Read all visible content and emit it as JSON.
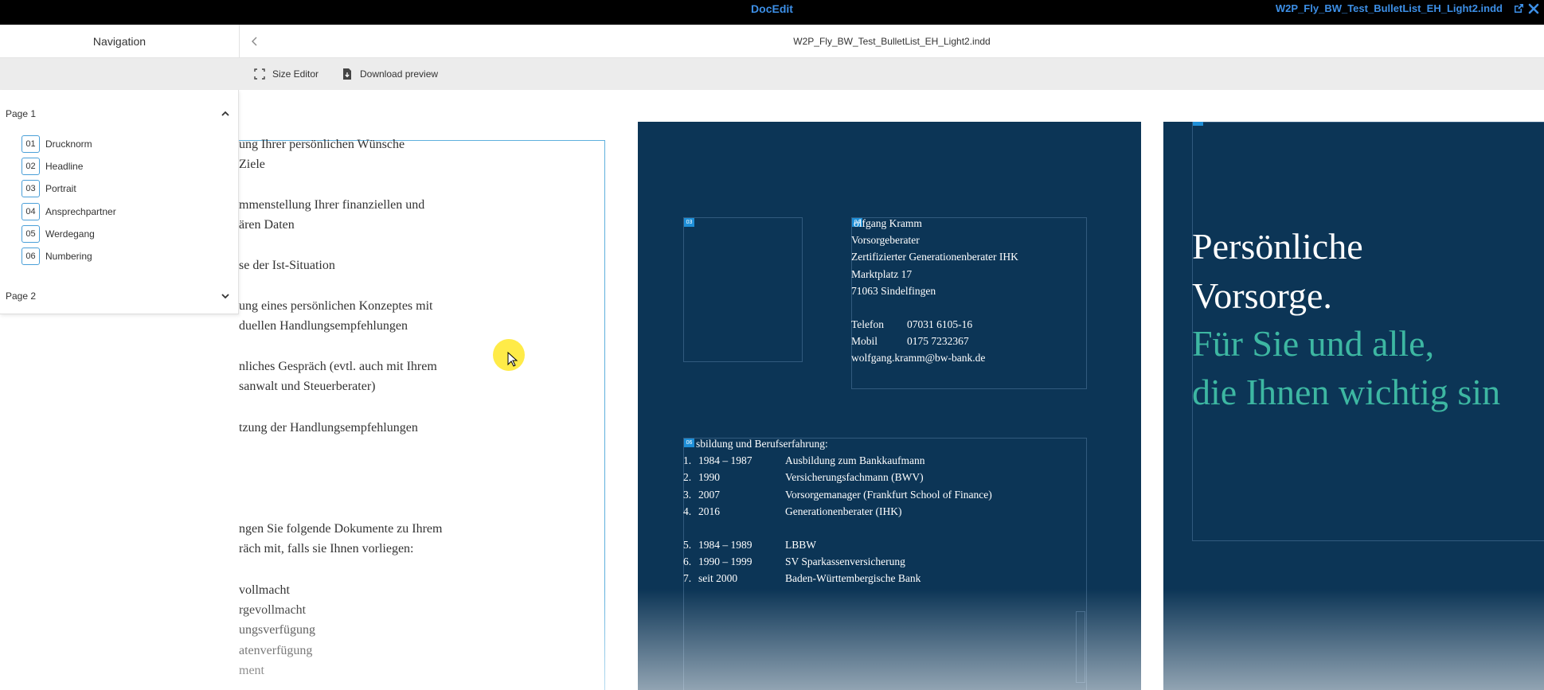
{
  "app": {
    "title": "DocEdit",
    "document_title": "W2P_Fly_BW_Test_BulletList_EH_Light2.indd"
  },
  "header": {
    "navigation_title": "Navigation",
    "file_name": "W2P_Fly_BW_Test_BulletList_EH_Light2.indd"
  },
  "toolbar": {
    "size_editor_label": "Size Editor",
    "download_preview_label": "Download preview"
  },
  "navigation": {
    "page1_label": "Page 1",
    "page2_label": "Page 2",
    "items": [
      {
        "num": "01",
        "label": "Drucknorm"
      },
      {
        "num": "02",
        "label": "Headline"
      },
      {
        "num": "03",
        "label": "Portrait"
      },
      {
        "num": "04",
        "label": "Ansprechpartner"
      },
      {
        "num": "05",
        "label": "Werdegang"
      },
      {
        "num": "06",
        "label": "Numbering"
      }
    ]
  },
  "page1_text": [
    "ung Ihrer persönlichen Wünsche",
    "Ziele",
    "mmenstellung Ihrer finanziellen und",
    "ären Daten",
    "se der Ist-Situation",
    "ung eines persönlichen Konzeptes mit",
    "duellen Handlungsempfehlungen",
    "nliches Gespräch (evtl. auch mit Ihrem",
    "sanwalt und Steuerberater)",
    "tzung der Handlungsempfehlungen",
    "ngen Sie folgende Dokumente zu Ihrem",
    "räch mit, falls sie Ihnen vorliegen:",
    "vollmacht",
    "rgevollmacht",
    "ungsverfügung",
    "atenverfügung",
    "ment"
  ],
  "contact": {
    "name": "olfgang Kramm",
    "role": "Vorsorgeberater",
    "cert": "Zertifizierter Generationenberater IHK",
    "street": "Marktplatz 17",
    "city": "71063 Sindelfingen",
    "phone_label": "Telefon",
    "phone": "07031 6105-16",
    "mobile_label": "Mobil",
    "mobile": "0175 7232367",
    "email": "wolfgang.kramm@bw-bank.de"
  },
  "career": {
    "heading": "sbildung und Berufserfahrung:",
    "rows": [
      {
        "n": "1.",
        "year": "1984 – 1987",
        "text": "Ausbildung zum Bankkaufmann"
      },
      {
        "n": "2.",
        "year": "1990",
        "text": "Versicherungsfachmann (BWV)"
      },
      {
        "n": "3.",
        "year": "2007",
        "text": "Vorsorgemanager (Frankfurt School of Finance)"
      },
      {
        "n": "4.",
        "year": "2016",
        "text": "Generationenberater (IHK)"
      },
      {
        "n": "5.",
        "year": "1984 – 1989",
        "text": "LBBW"
      },
      {
        "n": "6.",
        "year": "1990 – 1999",
        "text": "SV Sparkassenversicherung"
      },
      {
        "n": "7.",
        "year": "seit 2000",
        "text": "Baden-Württembergische Bank"
      }
    ]
  },
  "badges": {
    "portrait": "03",
    "contact": "04",
    "career": "06"
  },
  "hero": {
    "line1": "Persönliche",
    "line2": "Vorsorge.",
    "line3": "Für Sie und alle,",
    "line4": "die Ihnen wichtig sin"
  },
  "colors": {
    "accent_blue": "#3d8fe6",
    "dark_page": "#0c3556",
    "hero_green": "#3db7a2"
  }
}
